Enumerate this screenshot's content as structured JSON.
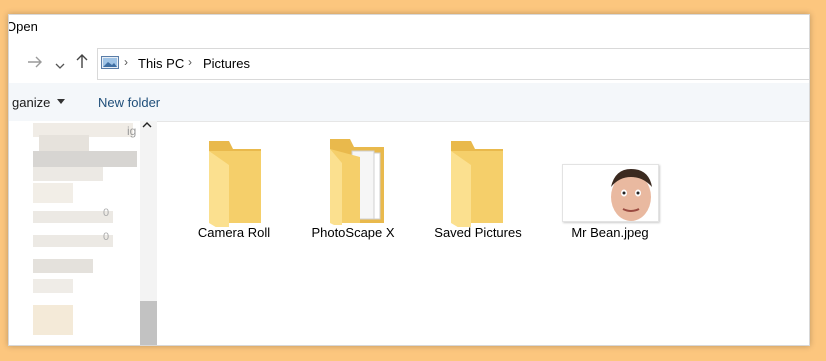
{
  "window": {
    "title": "Open"
  },
  "nav": {
    "forward_icon": "arrow-right-icon",
    "recent_icon": "chevron-down-icon",
    "up_icon": "arrow-up-icon"
  },
  "address": {
    "icon": "pictures-folder-icon",
    "crumbs": [
      "This PC",
      "Pictures"
    ]
  },
  "commands": {
    "organize": "ganize",
    "organize_icon": "caret-down-icon",
    "new_folder": "New folder"
  },
  "navpane": {
    "visible_fragments": [
      "ig",
      "0",
      "0"
    ]
  },
  "items": [
    {
      "label": "Camera Roll",
      "type": "folder"
    },
    {
      "label": "PhotoScape X",
      "type": "folder-with-documents"
    },
    {
      "label": "Saved Pictures",
      "type": "folder"
    },
    {
      "label": "Mr Bean.jpeg",
      "type": "image"
    }
  ],
  "colors": {
    "background": "#fcc67e",
    "folder": "#f8d775",
    "folder_dark": "#e9b94c",
    "accent_text": "#1f4e79",
    "command_bar": "#f4f7fa"
  }
}
